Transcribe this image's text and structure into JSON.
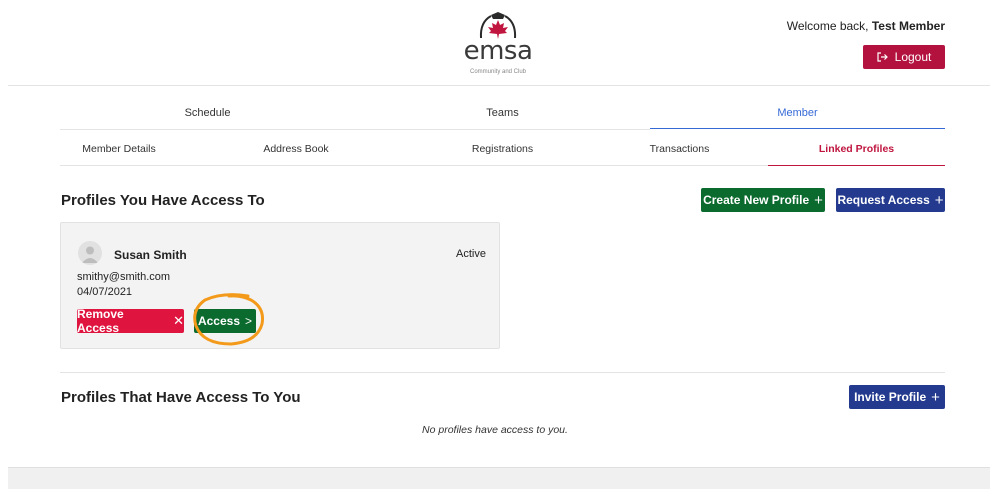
{
  "header": {
    "logo_word": "emsa",
    "logo_subtitle": "Community and Club",
    "welcome_prefix": "Welcome back, ",
    "welcome_name": "Test Member",
    "logout_label": "Logout",
    "brand_red": "#b3123f"
  },
  "main_nav": {
    "tabs": [
      {
        "label": "Schedule",
        "active": false
      },
      {
        "label": "Teams",
        "active": false
      },
      {
        "label": "Member",
        "active": true
      }
    ]
  },
  "sub_nav": {
    "tabs": [
      {
        "label": "Member Details",
        "active": false
      },
      {
        "label": "Address Book",
        "active": false
      },
      {
        "label": "Registrations",
        "active": false
      },
      {
        "label": "Transactions",
        "active": false
      },
      {
        "label": "Linked Profiles",
        "active": true
      }
    ]
  },
  "access_to": {
    "title": "Profiles You Have Access To",
    "create_label": "Create New Profile",
    "request_label": "Request Access",
    "profiles": [
      {
        "name": "Susan Smith",
        "status": "Active",
        "email": "smithy@smith.com",
        "date": "04/07/2021",
        "remove_label": "Remove Access",
        "access_label": "Access"
      }
    ]
  },
  "access_from": {
    "title": "Profiles That Have Access To You",
    "invite_label": "Invite Profile",
    "empty_text": "No profiles have access to you."
  },
  "colors": {
    "green": "#0b6a2e",
    "navy": "#233a8e",
    "red": "#e0153f",
    "active_blue": "#3569d6",
    "active_red": "#c0153f",
    "highlight_orange": "#f39a1b"
  }
}
